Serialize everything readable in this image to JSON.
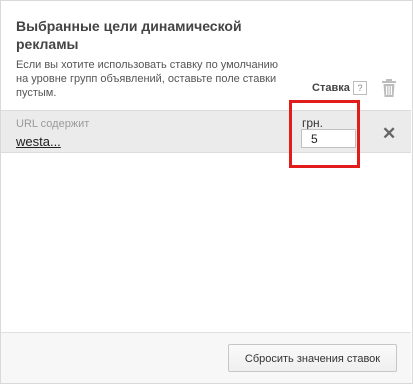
{
  "panel": {
    "title": "Выбранные цели динамической рекламы",
    "description": "Если вы хотите использовать ставку по умолчанию на уровне групп объявлений, оставьте поле ставки пустым.",
    "bid_header": "Ставка",
    "help_icon_glyph": "?"
  },
  "target_row": {
    "condition_label": "URL содержит",
    "condition_value": "westa...",
    "currency": "грн.",
    "bid_value": "5",
    "remove_glyph": "✕"
  },
  "footer": {
    "reset_button_label": "Сбросить значения ставок"
  },
  "colors": {
    "highlight": "#e21b1b",
    "row_background": "#ebebeb"
  }
}
